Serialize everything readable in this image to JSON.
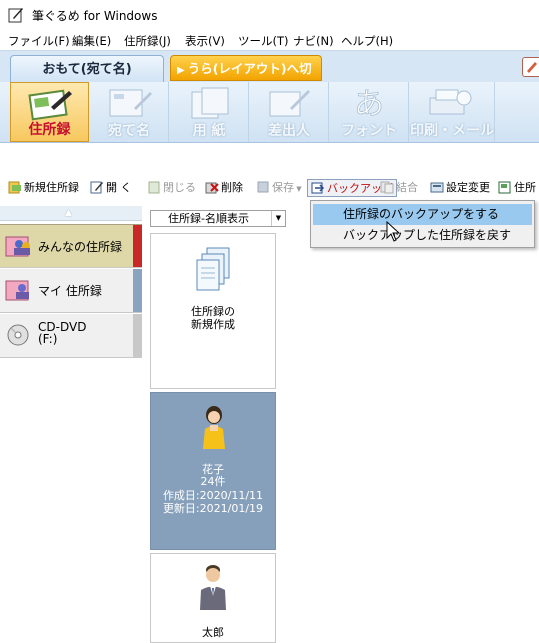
{
  "window": {
    "title": "筆ぐるめ for Windows"
  },
  "menu": {
    "items": [
      "ファイル(F)",
      "編集(E)",
      "住所録(J)",
      "表示(V)",
      "ツール(T)",
      "ナビ(N)",
      "ヘルプ(H)"
    ]
  },
  "tabs": {
    "front": "おもて(宛て名)",
    "back": "うら(レイアウト)へ切替"
  },
  "ribbon": {
    "buttons": [
      "住所録",
      "宛て名",
      "用 紙",
      "差出人",
      "フォント",
      "印刷・メール"
    ]
  },
  "toolbar": {
    "new_book": "新規住所録",
    "open": "開 く",
    "close": "閉じる",
    "delete": "削除",
    "save": "保存",
    "backup": "バックアップ",
    "merge": "結合",
    "settings": "設定変更",
    "truncated": "住所"
  },
  "backup_menu": {
    "items": [
      "住所録のバックアップをする",
      "バックアップした住所録を戻す"
    ]
  },
  "left_panel": {
    "items": [
      "みんなの住所録",
      "マイ 住所録",
      "CD-DVD",
      "(F:)"
    ]
  },
  "view": {
    "sort_option": "住所録-名順表示"
  },
  "cards": {
    "new": {
      "line1": "住所録の",
      "line2": "新規作成"
    },
    "hanako": {
      "name": "花子",
      "count": "24件",
      "created": "作成日:2020/11/11",
      "updated": "更新日:2021/01/19"
    },
    "taro": {
      "name": "太郎"
    }
  },
  "colors": {
    "tab_orange": "#f2a300",
    "selected_card": "#86a0bb",
    "menu_highlight": "#99c9ef",
    "active_ribbon_text": "#c8102e"
  }
}
